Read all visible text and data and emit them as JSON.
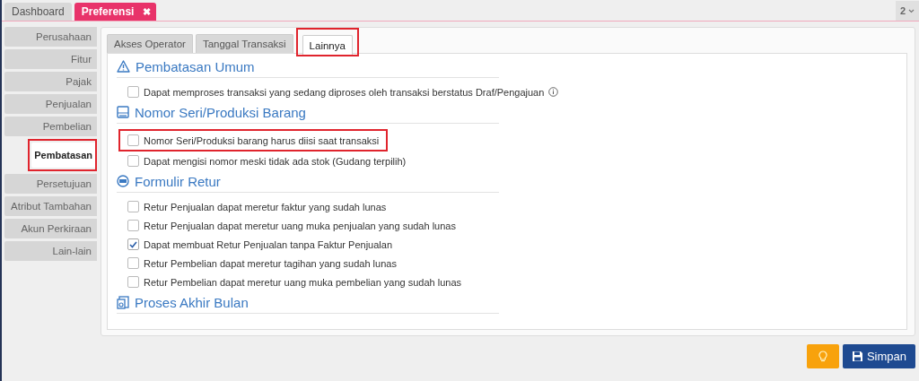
{
  "top_tabs": [
    {
      "label": "Dashboard",
      "selected": false,
      "closable": false
    },
    {
      "label": "Preferensi",
      "selected": true,
      "closable": true
    }
  ],
  "tab_close_glyph": "✖",
  "tab_count": "2",
  "sidebar": {
    "items": [
      {
        "label": "Perusahaan",
        "selected": false,
        "highlighted": false
      },
      {
        "label": "Fitur",
        "selected": false,
        "highlighted": false
      },
      {
        "label": "Pajak",
        "selected": false,
        "highlighted": false
      },
      {
        "label": "Penjualan",
        "selected": false,
        "highlighted": false
      },
      {
        "label": "Pembelian",
        "selected": false,
        "highlighted": false
      },
      {
        "label": "Pembatasan",
        "selected": true,
        "highlighted": true
      },
      {
        "label": "Persetujuan",
        "selected": false,
        "highlighted": false
      },
      {
        "label": "Atribut Tambahan",
        "selected": false,
        "highlighted": false
      },
      {
        "label": "Akun Perkiraan",
        "selected": false,
        "highlighted": false
      },
      {
        "label": "Lain-lain",
        "selected": false,
        "highlighted": false
      }
    ]
  },
  "tabs": [
    {
      "label": "Akses Operator",
      "selected": false,
      "highlighted": false
    },
    {
      "label": "Tanggal Transaksi",
      "selected": false,
      "highlighted": false
    },
    {
      "label": "Lainnya",
      "selected": true,
      "highlighted": true
    }
  ],
  "sections": [
    {
      "title": "Pembatasan Umum",
      "options": [
        {
          "label": "Dapat memproses transaksi yang sedang diproses oleh transaksi berstatus Draf/Pengajuan",
          "checked": false,
          "highlighted": false,
          "info": true
        }
      ]
    },
    {
      "title": "Nomor Seri/Produksi Barang",
      "options": [
        {
          "label": "Nomor Seri/Produksi barang harus diisi saat transaksi",
          "checked": false,
          "highlighted": true,
          "info": false
        },
        {
          "label": "Dapat mengisi nomor meski tidak ada stok (Gudang terpilih)",
          "checked": false,
          "highlighted": false,
          "info": false
        }
      ]
    },
    {
      "title": "Formulir Retur",
      "options": [
        {
          "label": "Retur Penjualan dapat meretur faktur yang sudah lunas",
          "checked": false,
          "highlighted": false,
          "info": false
        },
        {
          "label": "Retur Penjualan dapat meretur uang muka penjualan yang sudah lunas",
          "checked": false,
          "highlighted": false,
          "info": false
        },
        {
          "label": "Dapat membuat Retur Penjualan tanpa Faktur Penjualan",
          "checked": true,
          "highlighted": false,
          "info": false
        },
        {
          "label": "Retur Pembelian dapat meretur tagihan yang sudah lunas",
          "checked": false,
          "highlighted": false,
          "info": false
        },
        {
          "label": "Retur Pembelian dapat meretur uang muka pembelian yang sudah lunas",
          "checked": false,
          "highlighted": false,
          "info": false
        }
      ]
    },
    {
      "title": "Proses Akhir Bulan"
    }
  ],
  "buttons": {
    "save": "Simpan"
  }
}
